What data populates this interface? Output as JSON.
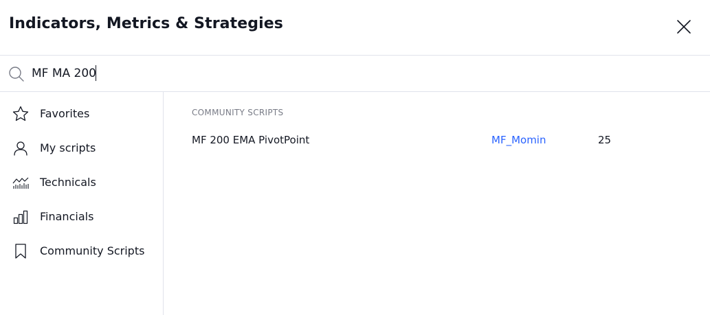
{
  "dialog": {
    "title": "Indicators, Metrics & Strategies",
    "close_icon": "close-icon"
  },
  "search": {
    "value": "MF MA 200",
    "icon": "search-icon"
  },
  "sidebar": {
    "items": [
      {
        "label": "Favorites",
        "icon": "star-icon"
      },
      {
        "label": "My scripts",
        "icon": "user-icon"
      },
      {
        "label": "Technicals",
        "icon": "technicals-icon"
      },
      {
        "label": "Financials",
        "icon": "bar-chart-icon"
      },
      {
        "label": "Community Scripts",
        "icon": "bookmark-icon"
      }
    ]
  },
  "results": {
    "section_title": "COMMUNITY SCRIPTS",
    "rows": [
      {
        "name": "MF 200 EMA PivotPoint",
        "author": "MF_Momin",
        "likes": "25"
      }
    ]
  },
  "colors": {
    "text": "#131722",
    "muted": "#787b86",
    "link": "#2962ff",
    "divider": "#e0e3eb"
  }
}
